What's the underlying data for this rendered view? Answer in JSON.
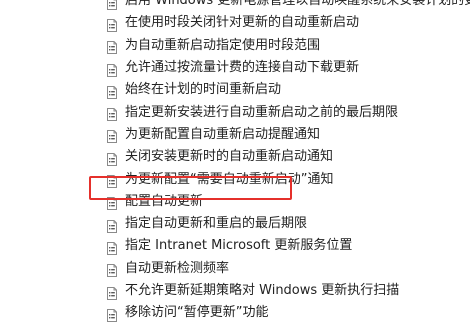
{
  "policy_list": {
    "items": [
      {
        "label": "启用 Windows 更新电源管理以自动唤醒系统来安装计划的更新",
        "icon": "policy-setting-icon"
      },
      {
        "label": "在使用时段关闭针对更新的自动重新启动",
        "icon": "policy-setting-icon"
      },
      {
        "label": "为自动重新启动指定使用时段范围",
        "icon": "policy-setting-icon"
      },
      {
        "label": "允许通过按流量计费的连接自动下载更新",
        "icon": "policy-setting-icon"
      },
      {
        "label": "始终在计划的时间重新启动",
        "icon": "policy-setting-icon"
      },
      {
        "label": "指定更新安装进行自动重新启动之前的最后期限",
        "icon": "policy-setting-icon"
      },
      {
        "label": "为更新配置自动重新启动提醒通知",
        "icon": "policy-setting-icon"
      },
      {
        "label": "关闭安装更新时的自动重新启动通知",
        "icon": "policy-setting-icon"
      },
      {
        "label": "为更新配置“需要自动重新启动”通知",
        "icon": "policy-setting-icon"
      },
      {
        "label": "配置自动更新",
        "icon": "policy-setting-icon",
        "highlighted": true
      },
      {
        "label": "指定自动更新和重启的最后期限",
        "icon": "policy-setting-icon"
      },
      {
        "label": "指定 Intranet Microsoft 更新服务位置",
        "icon": "policy-setting-icon"
      },
      {
        "label": "自动更新检测频率",
        "icon": "policy-setting-icon"
      },
      {
        "label": "不允许更新延期策略对 Windows 更新执行扫描",
        "icon": "policy-setting-icon"
      },
      {
        "label": "移除访问“暂停更新”功能",
        "icon": "policy-setting-icon"
      }
    ]
  },
  "colors": {
    "highlight_border": "#e5302b",
    "text": "#222222",
    "background": "#ffffff"
  }
}
